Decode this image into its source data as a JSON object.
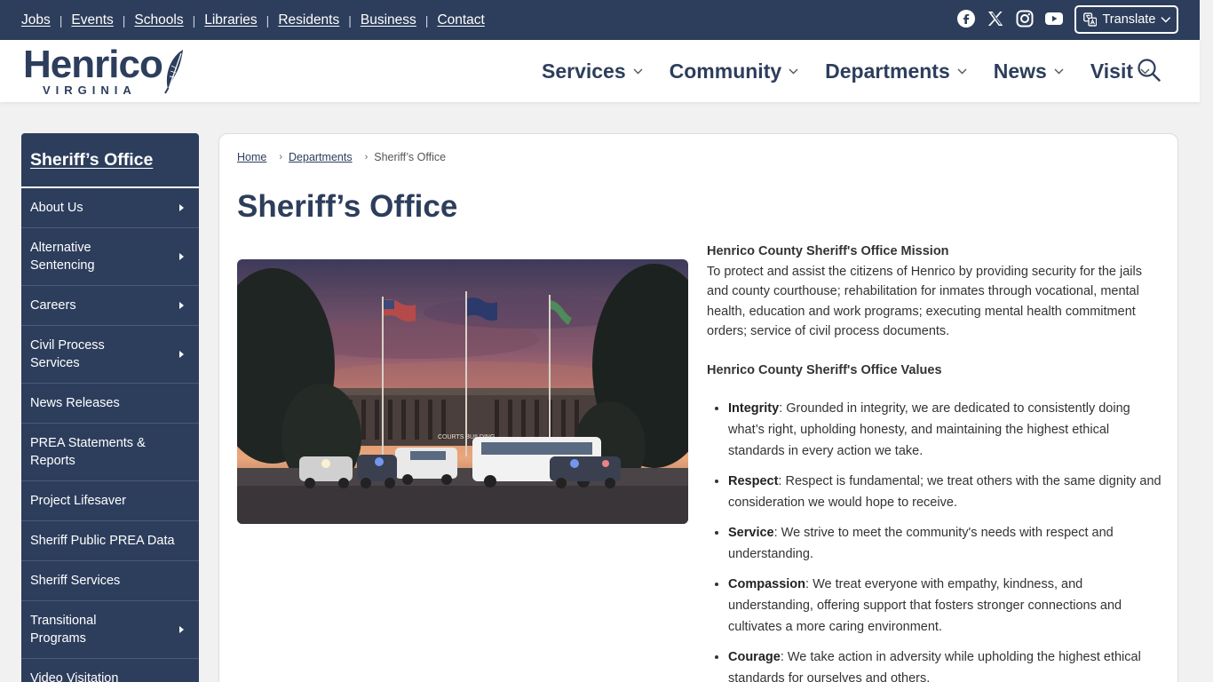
{
  "topbar": {
    "links": [
      "Jobs",
      "Events",
      "Schools",
      "Libraries",
      "Residents",
      "Business",
      "Contact"
    ],
    "social_icons": [
      "facebook-icon",
      "x-icon",
      "instagram-icon",
      "youtube-icon"
    ],
    "translate_label": "Translate"
  },
  "header": {
    "logo_word": "Henrico",
    "logo_sub": "VIRGINIA",
    "nav": [
      "Services",
      "Community",
      "Departments",
      "News",
      "Visit"
    ]
  },
  "sidebar": {
    "title": "Sheriff’s Office",
    "items": [
      {
        "label": "About Us",
        "has_children": true
      },
      {
        "label": "Alternative Sentencing",
        "has_children": true
      },
      {
        "label": "Careers",
        "has_children": true
      },
      {
        "label": "Civil Process Services",
        "has_children": true
      },
      {
        "label": "News Releases",
        "has_children": false
      },
      {
        "label": "PREA Statements & Reports",
        "has_children": false
      },
      {
        "label": "Project Lifesaver",
        "has_children": false
      },
      {
        "label": "Sheriff Public PREA Data",
        "has_children": false
      },
      {
        "label": "Sheriff Services",
        "has_children": false
      },
      {
        "label": "Transitional Programs",
        "has_children": true
      },
      {
        "label": "Video Visitation",
        "has_children": false
      }
    ]
  },
  "breadcrumb": {
    "home": "Home",
    "departments": "Departments",
    "current": "Sheriff’s Office"
  },
  "page": {
    "title": "Sheriff’s Office",
    "photo_sign": "COURTS BUILDING",
    "mission_head": "Henrico County Sheriff's Office Mission",
    "mission_text": "To protect and assist the citizens of Henrico by providing security for the jails and county courthouse; rehabilitation for inmates through vocational, mental health, education and work programs; executing mental health commitment orders; service of civil process documents.",
    "values_head": "Henrico County Sheriff's Office Values",
    "values": [
      {
        "term": "Integrity",
        "text": ": Grounded in integrity, we are dedicated to consistently doing what’s right, upholding honesty, and maintaining the highest ethical standards in every action we take."
      },
      {
        "term": "Respect",
        "text": ": Respect is fundamental; we treat others with the same dignity and consideration we would hope to receive."
      },
      {
        "term": "Service",
        "text": ": We strive to meet the community's needs with respect and understanding."
      },
      {
        "term": "Compassion",
        "text": ": We treat everyone with empathy, kindness, and understanding, offering support that fosters stronger connections and cultivates a more caring environment."
      },
      {
        "term": "Courage",
        "text": ": We take action in adversity while upholding the highest ethical standards for ourselves and others."
      }
    ]
  },
  "colors": {
    "navy": "#2d3e5c",
    "page_bg": "#f1f1f1"
  }
}
